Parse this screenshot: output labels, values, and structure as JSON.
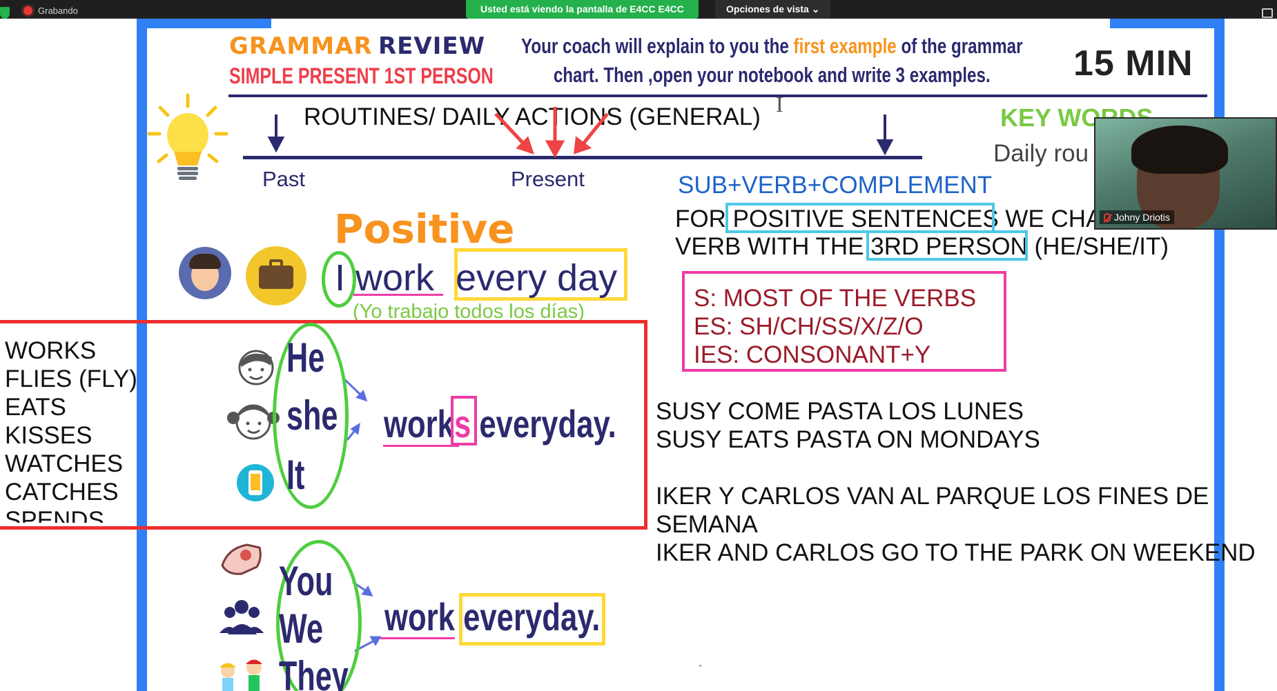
{
  "zoom": {
    "recording_label": "Grabando",
    "sharing_banner": "Usted está viendo la pantalla de E4CC E4CC",
    "view_options": "Opciones de vista",
    "view_options_chevron": "⌄"
  },
  "slide": {
    "title_word1": "GRAMMAR",
    "title_word2": "REVIEW",
    "subtitle": "SIMPLE PRESENT 1ST PERSON",
    "instruction_part1": "Your coach will explain to you the ",
    "instruction_highlight": "first example",
    "instruction_part2": " of the grammar",
    "instruction_line2": "chart. Then ,open your notebook and write 3 examples.",
    "timer": "15 MIN",
    "routines_heading": "ROUTINES/ DAILY ACTIONS (GENERAL)",
    "key_words": "KEY WORDS",
    "daily_routines_partial": "Daily rou",
    "past": "Past",
    "present": "Present",
    "positive": "Positive",
    "example_I": "I",
    "example_work": "work",
    "example_every_day": "every day",
    "example_translation": "(Yo trabajo todos los días)",
    "pronouns_third": [
      "He",
      "she",
      "It"
    ],
    "third_example_verb": "work",
    "third_example_s": "s",
    "third_example_rest": "everyday.",
    "pronouns_plural": [
      "You",
      "We",
      "They"
    ],
    "plural_example_verb": "work",
    "plural_example_rest": "everyday."
  },
  "annotations": {
    "formula": "SUB+VERB+COMPLEMENT",
    "rule_line1_a": "FOR ",
    "rule_line1_boxed": "POSITIVE SENTENCES",
    "rule_line1_b": " WE CHA",
    "rule_line2_a": "VERB WITH THE ",
    "rule_line2_boxed": "3RD PERSON",
    "rule_line2_b": " (HE/SHE/IT)",
    "spelling_rules": [
      "S: MOST OF THE VERBS",
      "ES: SH/CH/SS/X/Z/O",
      "IES: CONSONANT+Y"
    ],
    "verb_list": [
      "WORKS",
      "FLIES (FLY)",
      "EATS",
      "KISSES",
      "WATCHES",
      "CATCHES",
      "SPENDS"
    ],
    "example_es_1": "SUSY COME PASTA LOS LUNES",
    "example_en_1": "SUSY EATS PASTA ON MONDAYS",
    "example_es_2a": "IKER Y CARLOS VAN AL PARQUE LOS FINES DE",
    "example_es_2b": "SEMANA",
    "example_en_2": "IKER AND CARLOS GO TO THE PARK ON WEEKEND"
  },
  "participant": {
    "name": "Johny Driotis"
  },
  "colors": {
    "slide_border": "#2f80f5",
    "title_orange": "#f7931e",
    "navy": "#2b2a6e",
    "red_subtitle": "#ee3e4b",
    "green": "#7ac943",
    "cyan_box": "#4cc9e6",
    "pink_box": "#ee3ca5",
    "red_box": "#ef2e2e",
    "yellow_box": "#ffd838",
    "zoom_green": "#24b14c"
  },
  "icons": [
    "shield-icon",
    "record-dot-icon",
    "chevron-down-icon",
    "lightbulb-icon",
    "arrow-down-icon",
    "boy-avatar-icon",
    "briefcase-icon",
    "boy-face-icon",
    "girl-face-icon",
    "phone-icon",
    "pointing-hand-icon",
    "group-icon",
    "kids-icon",
    "muted-mic-icon",
    "text-cursor-icon"
  ]
}
